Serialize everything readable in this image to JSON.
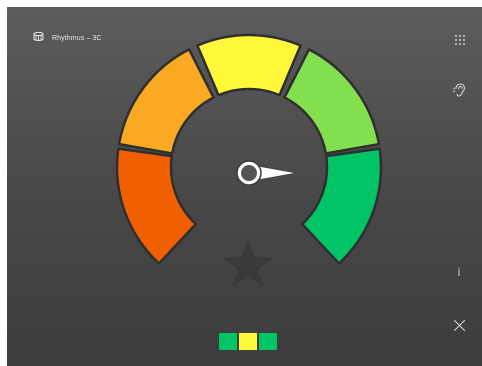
{
  "app": {
    "title": "Rhythmus – 3C",
    "title_icon": "drum-icon"
  },
  "toolbar": {
    "icons": [
      "keypad-grid-icon",
      "ear-icon",
      "info-icon",
      "close-icon"
    ],
    "info_label": "i"
  },
  "gauge": {
    "segments": [
      {
        "name": "red-orange",
        "color": "#f06000"
      },
      {
        "name": "orange",
        "color": "#f9aa22"
      },
      {
        "name": "yellow",
        "color": "#fff739"
      },
      {
        "name": "light-green",
        "color": "#82e04e"
      },
      {
        "name": "green",
        "color": "#00c465"
      }
    ],
    "needle_icon": "needle-pointer",
    "center_icon": "star-icon"
  },
  "score_boxes": [
    {
      "color": "#00c465"
    },
    {
      "color": "#fff739"
    },
    {
      "color": "#00c465"
    }
  ]
}
